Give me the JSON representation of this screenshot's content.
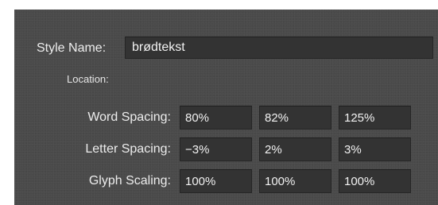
{
  "style_name": {
    "label": "Style Name:",
    "value": "brødtekst"
  },
  "location": {
    "label": "Location:"
  },
  "spacing": {
    "word": {
      "label": "Word Spacing:",
      "min": "80%",
      "desired": "82%",
      "max": "125%"
    },
    "letter": {
      "label": "Letter Spacing:",
      "min": "−3%",
      "desired": "2%",
      "max": "3%"
    },
    "glyph": {
      "label": "Glyph Scaling:",
      "min": "100%",
      "desired": "100%",
      "max": "100%"
    }
  },
  "colors": {
    "panel_background": "#4a4a4a",
    "field_background": "#333333",
    "text": "#ededed"
  }
}
